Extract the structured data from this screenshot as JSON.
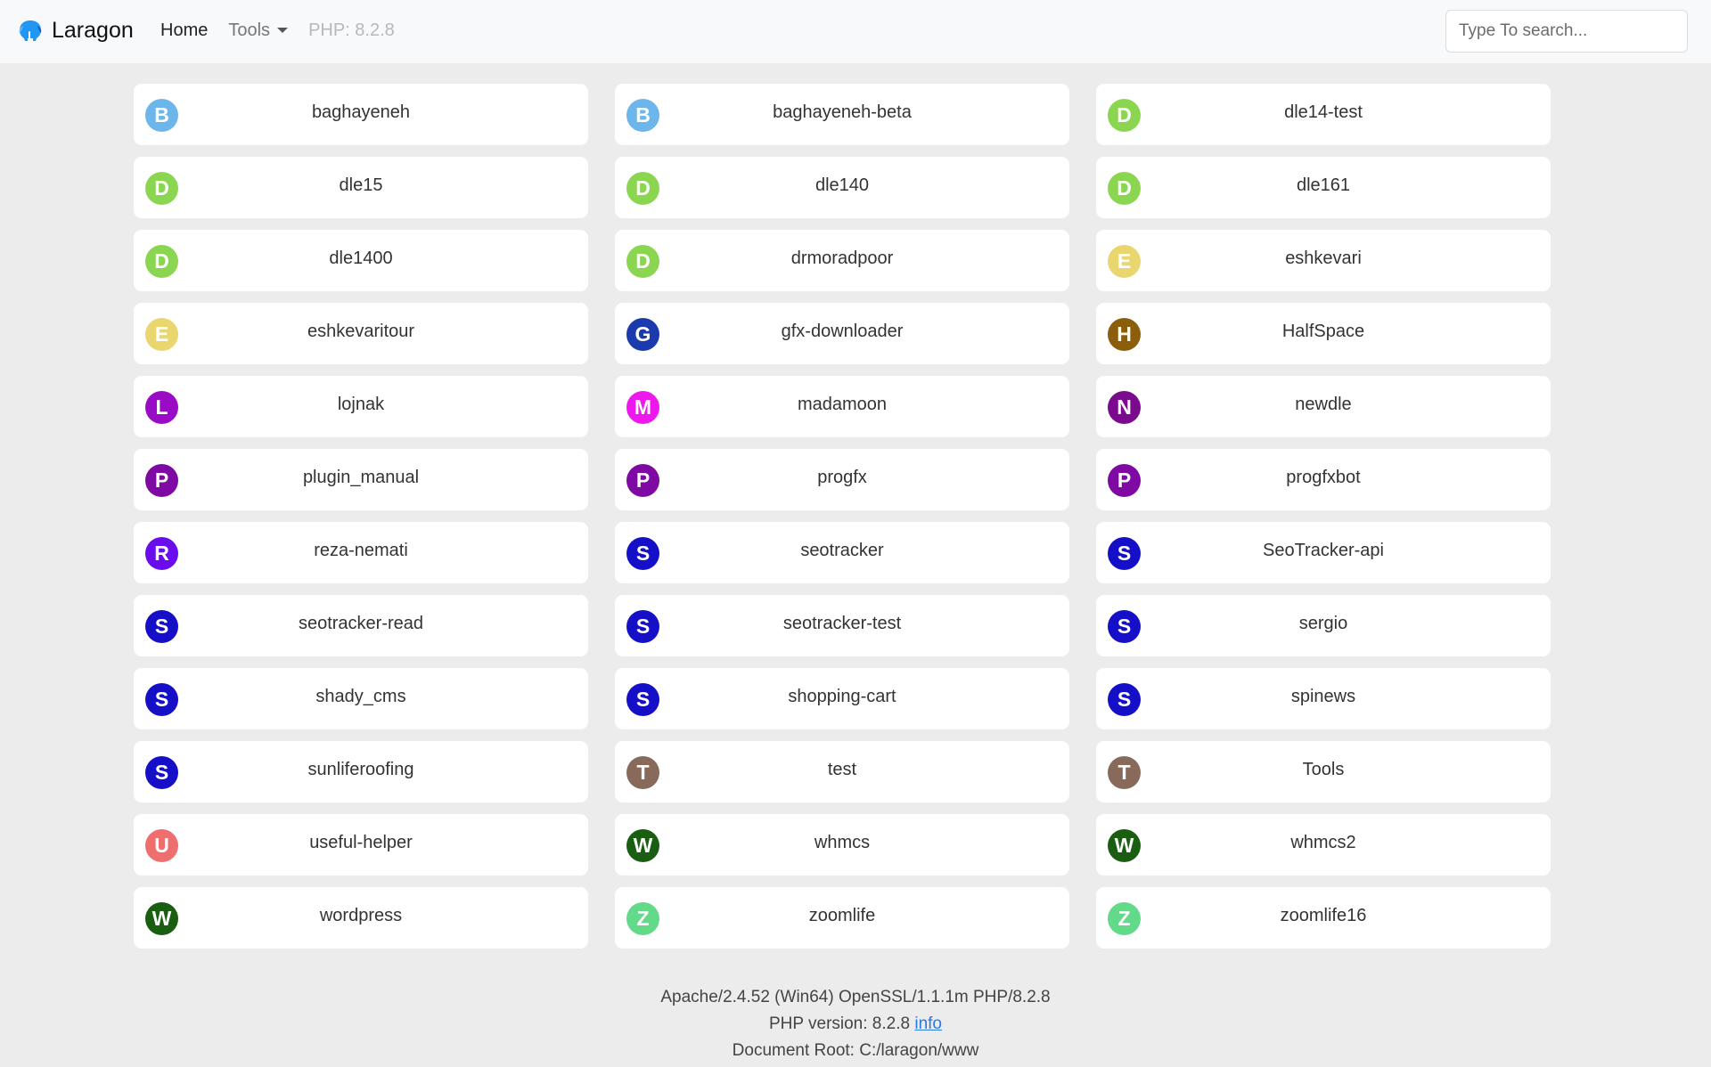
{
  "navbar": {
    "brand": "Laragon",
    "brand_icon": "laragon-elephant-icon",
    "links": {
      "home": "Home",
      "tools": "Tools",
      "php": "PHP: 8.2.8"
    },
    "search_placeholder": "Type To search..."
  },
  "projects": [
    {
      "name": "baghayeneh",
      "letter": "B",
      "color": "#6cb6ec"
    },
    {
      "name": "baghayeneh-beta",
      "letter": "B",
      "color": "#6cb6ec"
    },
    {
      "name": "dle14-test",
      "letter": "D",
      "color": "#8bd650"
    },
    {
      "name": "dle15",
      "letter": "D",
      "color": "#8bd650"
    },
    {
      "name": "dle140",
      "letter": "D",
      "color": "#8bd650"
    },
    {
      "name": "dle161",
      "letter": "D",
      "color": "#8bd650"
    },
    {
      "name": "dle1400",
      "letter": "D",
      "color": "#8bd650"
    },
    {
      "name": "drmoradpoor",
      "letter": "D",
      "color": "#8bd650"
    },
    {
      "name": "eshkevari",
      "letter": "E",
      "color": "#ead66e"
    },
    {
      "name": "eshkevaritour",
      "letter": "E",
      "color": "#ead66e"
    },
    {
      "name": "gfx-downloader",
      "letter": "G",
      "color": "#1a3aad"
    },
    {
      "name": "HalfSpace",
      "letter": "H",
      "color": "#8b5e0b"
    },
    {
      "name": "lojnak",
      "letter": "L",
      "color": "#9a0bc6"
    },
    {
      "name": "madamoon",
      "letter": "M",
      "color": "#ee18ee"
    },
    {
      "name": "newdle",
      "letter": "N",
      "color": "#7a0a8e"
    },
    {
      "name": "plugin_manual",
      "letter": "P",
      "color": "#7e0aa3"
    },
    {
      "name": "progfx",
      "letter": "P",
      "color": "#7e0aa3"
    },
    {
      "name": "progfxbot",
      "letter": "P",
      "color": "#7e0aa3"
    },
    {
      "name": "reza-nemati",
      "letter": "R",
      "color": "#6a0dee"
    },
    {
      "name": "seotracker",
      "letter": "S",
      "color": "#160fc8"
    },
    {
      "name": "SeoTracker-api",
      "letter": "S",
      "color": "#160fc8"
    },
    {
      "name": "seotracker-read",
      "letter": "S",
      "color": "#160fc8"
    },
    {
      "name": "seotracker-test",
      "letter": "S",
      "color": "#160fc8"
    },
    {
      "name": "sergio",
      "letter": "S",
      "color": "#160fc8"
    },
    {
      "name": "shady_cms",
      "letter": "S",
      "color": "#160fc8"
    },
    {
      "name": "shopping-cart",
      "letter": "S",
      "color": "#160fc8"
    },
    {
      "name": "spinews",
      "letter": "S",
      "color": "#160fc8"
    },
    {
      "name": "sunliferoofing",
      "letter": "S",
      "color": "#160fc8"
    },
    {
      "name": "test",
      "letter": "T",
      "color": "#876a5a"
    },
    {
      "name": "Tools",
      "letter": "T",
      "color": "#876a5a"
    },
    {
      "name": "useful-helper",
      "letter": "U",
      "color": "#ef6f6f"
    },
    {
      "name": "whmcs",
      "letter": "W",
      "color": "#1a5e12"
    },
    {
      "name": "whmcs2",
      "letter": "W",
      "color": "#1a5e12"
    },
    {
      "name": "wordpress",
      "letter": "W",
      "color": "#1a5e12"
    },
    {
      "name": "zoomlife",
      "letter": "Z",
      "color": "#63d98a"
    },
    {
      "name": "zoomlife16",
      "letter": "Z",
      "color": "#63d98a"
    }
  ],
  "footer": {
    "server": "Apache/2.4.52 (Win64) OpenSSL/1.1.1m PHP/8.2.8",
    "php_version_label": "PHP version: 8.2.8",
    "info_link": "info",
    "document_root": "Document Root: C:/laragon/www"
  }
}
